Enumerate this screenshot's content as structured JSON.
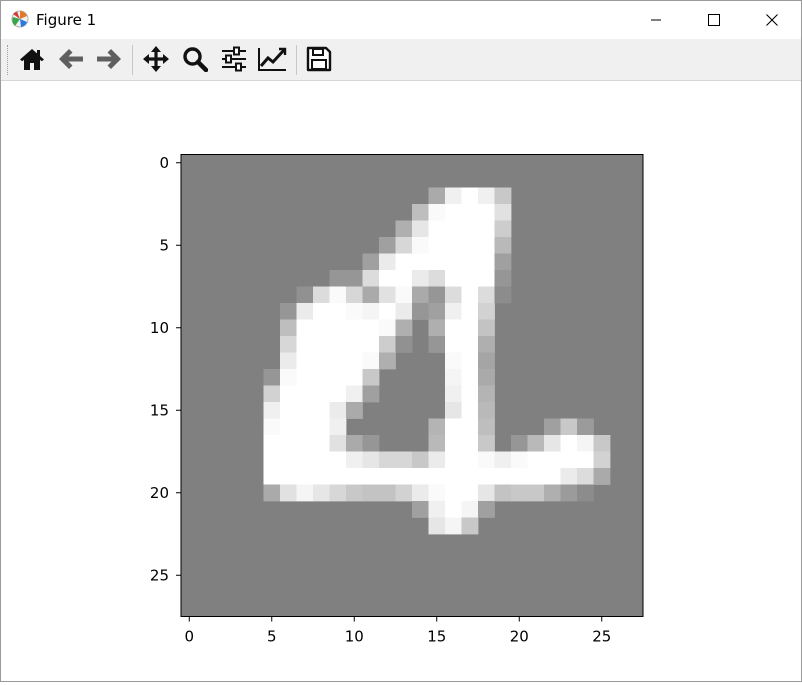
{
  "window": {
    "title": "Figure 1"
  },
  "icons": {
    "app": "matplotlib-app-icon",
    "minimize": "minimize-icon",
    "maximize": "maximize-icon",
    "close": "close-icon",
    "home": "home-icon",
    "back": "arrow-left-icon",
    "forward": "arrow-right-icon",
    "pan": "move-icon",
    "zoom": "magnifier-icon",
    "configure": "sliders-icon",
    "edit": "line-chart-icon",
    "save": "floppy-disk-icon"
  },
  "chart_data": {
    "type": "heatmap",
    "title": "",
    "xlabel": "",
    "ylabel": "",
    "colormap": "gray",
    "shape": [
      28,
      28
    ],
    "xlim": [
      -0.5,
      27.5
    ],
    "ylim": [
      27.5,
      -0.5
    ],
    "xticks": [
      0,
      5,
      10,
      15,
      20,
      25
    ],
    "yticks": [
      0,
      5,
      10,
      15,
      20,
      25
    ],
    "background_value": 128,
    "nonzero_pixels": [
      [
        2,
        15,
        170
      ],
      [
        2,
        16,
        240
      ],
      [
        2,
        17,
        255
      ],
      [
        2,
        18,
        240
      ],
      [
        2,
        19,
        200
      ],
      [
        3,
        14,
        190
      ],
      [
        3,
        15,
        250
      ],
      [
        3,
        16,
        255
      ],
      [
        3,
        17,
        255
      ],
      [
        3,
        18,
        255
      ],
      [
        3,
        19,
        225
      ],
      [
        4,
        13,
        175
      ],
      [
        4,
        14,
        230
      ],
      [
        4,
        15,
        255
      ],
      [
        4,
        16,
        255
      ],
      [
        4,
        17,
        255
      ],
      [
        4,
        18,
        255
      ],
      [
        4,
        19,
        205
      ],
      [
        5,
        12,
        160
      ],
      [
        5,
        13,
        215
      ],
      [
        5,
        14,
        250
      ],
      [
        5,
        15,
        255
      ],
      [
        5,
        16,
        255
      ],
      [
        5,
        17,
        255
      ],
      [
        5,
        18,
        255
      ],
      [
        5,
        19,
        185
      ],
      [
        6,
        11,
        160
      ],
      [
        6,
        12,
        235
      ],
      [
        6,
        13,
        255
      ],
      [
        6,
        14,
        255
      ],
      [
        6,
        15,
        255
      ],
      [
        6,
        16,
        255
      ],
      [
        6,
        17,
        255
      ],
      [
        6,
        18,
        255
      ],
      [
        6,
        19,
        160
      ],
      [
        7,
        9,
        150
      ],
      [
        7,
        10,
        150
      ],
      [
        7,
        11,
        220
      ],
      [
        7,
        12,
        255
      ],
      [
        7,
        13,
        255
      ],
      [
        7,
        14,
        235
      ],
      [
        7,
        15,
        220
      ],
      [
        7,
        16,
        255
      ],
      [
        7,
        17,
        255
      ],
      [
        7,
        18,
        255
      ],
      [
        7,
        19,
        150
      ],
      [
        8,
        7,
        145
      ],
      [
        8,
        8,
        220
      ],
      [
        8,
        9,
        250
      ],
      [
        8,
        10,
        215
      ],
      [
        8,
        11,
        170
      ],
      [
        8,
        12,
        225
      ],
      [
        8,
        13,
        250
      ],
      [
        8,
        14,
        170
      ],
      [
        8,
        15,
        150
      ],
      [
        8,
        16,
        220
      ],
      [
        8,
        17,
        255
      ],
      [
        8,
        18,
        220
      ],
      [
        8,
        19,
        140
      ],
      [
        9,
        6,
        150
      ],
      [
        9,
        7,
        235
      ],
      [
        9,
        8,
        255
      ],
      [
        9,
        9,
        255
      ],
      [
        9,
        10,
        250
      ],
      [
        9,
        11,
        245
      ],
      [
        9,
        12,
        255
      ],
      [
        9,
        13,
        235
      ],
      [
        9,
        14,
        150
      ],
      [
        9,
        15,
        160
      ],
      [
        9,
        16,
        240
      ],
      [
        9,
        17,
        255
      ],
      [
        9,
        18,
        210
      ],
      [
        10,
        6,
        190
      ],
      [
        10,
        7,
        255
      ],
      [
        10,
        8,
        255
      ],
      [
        10,
        9,
        255
      ],
      [
        10,
        10,
        255
      ],
      [
        10,
        11,
        255
      ],
      [
        10,
        12,
        250
      ],
      [
        10,
        13,
        175
      ],
      [
        10,
        15,
        175
      ],
      [
        10,
        16,
        255
      ],
      [
        10,
        17,
        255
      ],
      [
        10,
        18,
        195
      ],
      [
        11,
        6,
        215
      ],
      [
        11,
        7,
        255
      ],
      [
        11,
        8,
        255
      ],
      [
        11,
        9,
        255
      ],
      [
        11,
        10,
        255
      ],
      [
        11,
        11,
        255
      ],
      [
        11,
        12,
        205
      ],
      [
        11,
        13,
        145
      ],
      [
        11,
        15,
        150
      ],
      [
        11,
        16,
        255
      ],
      [
        11,
        17,
        255
      ],
      [
        11,
        18,
        175
      ],
      [
        12,
        6,
        235
      ],
      [
        12,
        7,
        255
      ],
      [
        12,
        8,
        255
      ],
      [
        12,
        9,
        255
      ],
      [
        12,
        10,
        255
      ],
      [
        12,
        11,
        250
      ],
      [
        12,
        12,
        175
      ],
      [
        12,
        16,
        250
      ],
      [
        12,
        17,
        255
      ],
      [
        12,
        18,
        165
      ],
      [
        13,
        5,
        150
      ],
      [
        13,
        6,
        250
      ],
      [
        13,
        7,
        255
      ],
      [
        13,
        8,
        255
      ],
      [
        13,
        9,
        255
      ],
      [
        13,
        10,
        255
      ],
      [
        13,
        11,
        200
      ],
      [
        13,
        16,
        245
      ],
      [
        13,
        17,
        255
      ],
      [
        13,
        18,
        170
      ],
      [
        14,
        5,
        210
      ],
      [
        14,
        6,
        255
      ],
      [
        14,
        7,
        255
      ],
      [
        14,
        8,
        255
      ],
      [
        14,
        9,
        255
      ],
      [
        14,
        10,
        240
      ],
      [
        14,
        11,
        160
      ],
      [
        14,
        16,
        240
      ],
      [
        14,
        17,
        255
      ],
      [
        14,
        18,
        180
      ],
      [
        15,
        5,
        240
      ],
      [
        15,
        6,
        255
      ],
      [
        15,
        7,
        255
      ],
      [
        15,
        8,
        255
      ],
      [
        15,
        9,
        235
      ],
      [
        15,
        10,
        170
      ],
      [
        15,
        16,
        230
      ],
      [
        15,
        17,
        255
      ],
      [
        15,
        18,
        185
      ],
      [
        16,
        5,
        250
      ],
      [
        16,
        6,
        255
      ],
      [
        16,
        7,
        255
      ],
      [
        16,
        8,
        255
      ],
      [
        16,
        9,
        240
      ],
      [
        16,
        15,
        180
      ],
      [
        16,
        16,
        255
      ],
      [
        16,
        17,
        255
      ],
      [
        16,
        18,
        190
      ],
      [
        16,
        22,
        160
      ],
      [
        16,
        23,
        200
      ],
      [
        16,
        24,
        155
      ],
      [
        17,
        5,
        255
      ],
      [
        17,
        6,
        255
      ],
      [
        17,
        7,
        255
      ],
      [
        17,
        8,
        255
      ],
      [
        17,
        9,
        225
      ],
      [
        17,
        10,
        170
      ],
      [
        17,
        11,
        150
      ],
      [
        17,
        15,
        185
      ],
      [
        17,
        16,
        255
      ],
      [
        17,
        17,
        255
      ],
      [
        17,
        18,
        200
      ],
      [
        17,
        20,
        150
      ],
      [
        17,
        21,
        185
      ],
      [
        17,
        22,
        230
      ],
      [
        17,
        23,
        255
      ],
      [
        17,
        24,
        245
      ],
      [
        17,
        25,
        200
      ],
      [
        18,
        5,
        255
      ],
      [
        18,
        6,
        255
      ],
      [
        18,
        7,
        255
      ],
      [
        18,
        8,
        255
      ],
      [
        18,
        9,
        255
      ],
      [
        18,
        10,
        240
      ],
      [
        18,
        11,
        230
      ],
      [
        18,
        12,
        215
      ],
      [
        18,
        13,
        215
      ],
      [
        18,
        14,
        200
      ],
      [
        18,
        15,
        235
      ],
      [
        18,
        16,
        255
      ],
      [
        18,
        17,
        255
      ],
      [
        18,
        18,
        250
      ],
      [
        18,
        19,
        240
      ],
      [
        18,
        20,
        250
      ],
      [
        18,
        21,
        255
      ],
      [
        18,
        22,
        255
      ],
      [
        18,
        23,
        255
      ],
      [
        18,
        24,
        255
      ],
      [
        18,
        25,
        210
      ],
      [
        19,
        5,
        255
      ],
      [
        19,
        6,
        255
      ],
      [
        19,
        7,
        255
      ],
      [
        19,
        8,
        255
      ],
      [
        19,
        9,
        255
      ],
      [
        19,
        10,
        255
      ],
      [
        19,
        11,
        255
      ],
      [
        19,
        12,
        255
      ],
      [
        19,
        13,
        255
      ],
      [
        19,
        14,
        255
      ],
      [
        19,
        15,
        255
      ],
      [
        19,
        16,
        255
      ],
      [
        19,
        17,
        255
      ],
      [
        19,
        18,
        255
      ],
      [
        19,
        19,
        255
      ],
      [
        19,
        20,
        255
      ],
      [
        19,
        21,
        255
      ],
      [
        19,
        22,
        255
      ],
      [
        19,
        23,
        235
      ],
      [
        19,
        24,
        220
      ],
      [
        19,
        25,
        170
      ],
      [
        20,
        5,
        170
      ],
      [
        20,
        6,
        225
      ],
      [
        20,
        7,
        245
      ],
      [
        20,
        8,
        230
      ],
      [
        20,
        9,
        215
      ],
      [
        20,
        10,
        200
      ],
      [
        20,
        11,
        195
      ],
      [
        20,
        12,
        195
      ],
      [
        20,
        13,
        210
      ],
      [
        20,
        14,
        235
      ],
      [
        20,
        15,
        250
      ],
      [
        20,
        16,
        255
      ],
      [
        20,
        17,
        255
      ],
      [
        20,
        18,
        230
      ],
      [
        20,
        19,
        195
      ],
      [
        20,
        20,
        200
      ],
      [
        20,
        21,
        200
      ],
      [
        20,
        22,
        175
      ],
      [
        20,
        23,
        155
      ],
      [
        20,
        24,
        140
      ],
      [
        21,
        14,
        160
      ],
      [
        21,
        15,
        240
      ],
      [
        21,
        16,
        255
      ],
      [
        21,
        17,
        245
      ],
      [
        21,
        18,
        160
      ],
      [
        22,
        15,
        230
      ],
      [
        22,
        16,
        245
      ],
      [
        22,
        17,
        200
      ]
    ]
  }
}
